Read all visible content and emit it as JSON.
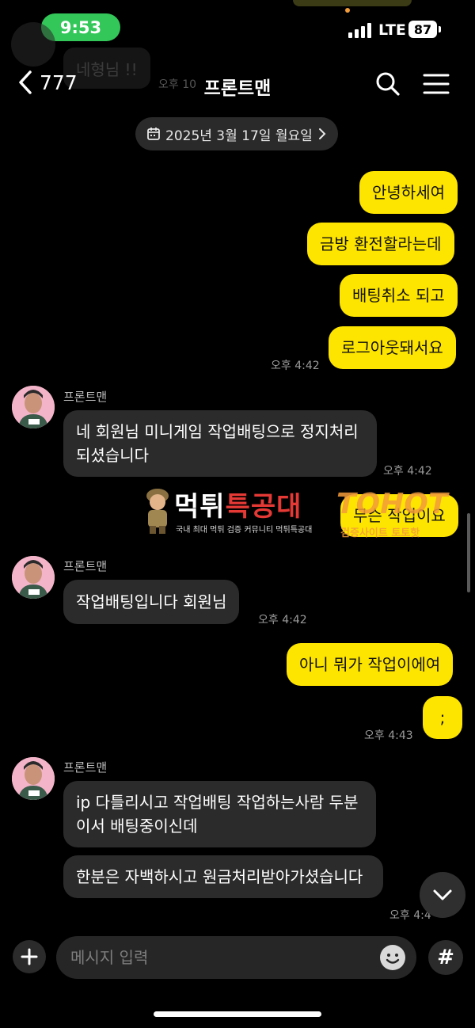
{
  "status_bar": {
    "time": "9:53",
    "network": "LTE",
    "battery": "87"
  },
  "background_ghost": {
    "bubble_text": "네형님 !!",
    "time": "오후 10"
  },
  "header": {
    "back_count": "777",
    "title": "프론트맨"
  },
  "date_divider": "2025년 3월 17일 월요일",
  "sender_name": "프론트맨",
  "messages": [
    {
      "side": "me",
      "text": "안녕하세여"
    },
    {
      "side": "me",
      "text": "금방 환전할라는데"
    },
    {
      "side": "me",
      "text": "배팅취소 되고"
    },
    {
      "side": "me",
      "text": "로그아웃돼서요",
      "time": "오후 4:42"
    },
    {
      "side": "them",
      "text": "네 회원님 미니게임 작업배팅으로 정지처리되셨습니다",
      "time": "오후 4:42"
    },
    {
      "side": "me",
      "text": "무슨 작업이요"
    },
    {
      "side": "them",
      "text": "작업배팅입니다 회원님",
      "time": "오후 4:42"
    },
    {
      "side": "me",
      "text": "아니 뭐가 작업이에여"
    },
    {
      "side": "me",
      "text": ";",
      "time": "오후 4:43"
    },
    {
      "side": "them",
      "text": "ip 다틀리시고 작업배팅 작업하는사람 두분이서 배팅중이신데"
    },
    {
      "side": "them",
      "text": "한분은 자백하시고 원금처리받아가셨습니다",
      "time": "오후 4:4"
    }
  ],
  "watermark": {
    "main_a": "먹튀",
    "main_b": "특공대",
    "sub": "국내 최대 먹튀 검증 커뮤니티 먹튀특공대",
    "partner": "TOHOT",
    "partner_sub": "검증사이트 토토핫"
  },
  "input": {
    "placeholder": "메시지 입력"
  },
  "icons": [
    "back-chevron-icon",
    "search-icon",
    "menu-icon",
    "calendar-icon",
    "chevron-right-icon",
    "plus-icon",
    "emoji-icon",
    "hash-icon",
    "chevron-down-icon"
  ],
  "colors": {
    "my_bubble": "#fee500",
    "their_bubble": "#2b2b2b",
    "time_pill": "#33c759",
    "background": "#000000"
  }
}
